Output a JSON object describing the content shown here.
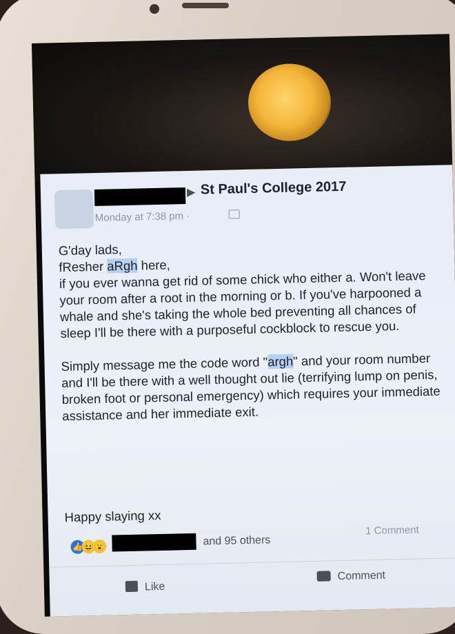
{
  "post": {
    "group": "St Paul's College 2017",
    "timestamp": "Monday at 7:38 pm ·",
    "paragraph1": {
      "line1": "G'day lads,",
      "line2_pre": "fResher ",
      "line2_hl": "aRgh",
      "line2_post": " here,",
      "rest": "if you ever wanna get rid of some chick who either a. Won't leave your room after a root in the morning or b. If you've harpooned a whale and she's taking the whole bed preventing all chances of sleep I'll be there with a purposeful cockblock to rescue you."
    },
    "paragraph2": {
      "pre": "Simply message me the code word \"",
      "hl": "argh",
      "post": "\" and your room number and I'll be there with a well thought out lie (terrifying lump on penis, broken foot or personal emergency) which requires your immediate assistance and her immediate exit."
    },
    "signoff": "Happy slaying xx"
  },
  "reactions": {
    "text": "and 95 others",
    "comment_count": "1 Comment",
    "icons": [
      "like-icon",
      "haha-icon",
      "wow-icon"
    ]
  },
  "actions": {
    "like_label": "Like",
    "comment_label": "Comment"
  },
  "colors": {
    "highlight": "#b7d0f2",
    "facebook_blue": "#2f6fe6"
  }
}
